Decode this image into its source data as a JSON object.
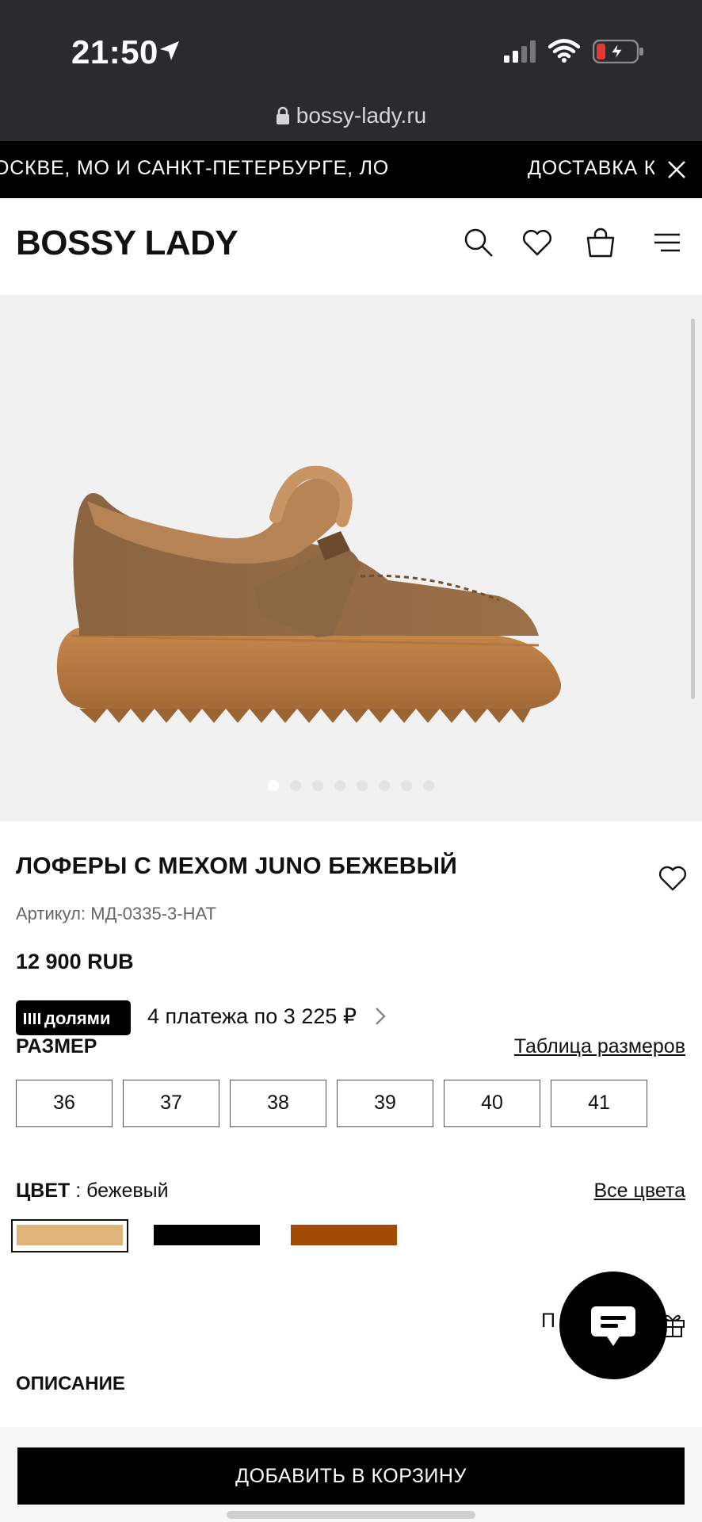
{
  "status_bar": {
    "time": "21:50",
    "url": "bossy-lady.ru",
    "battery_color": "#e53935"
  },
  "promo": {
    "text_left": "ОСКВЕ, МО И САНКТ-ПЕТЕРБУРГЕ, ЛО",
    "text_right": "ДОСТАВКА К"
  },
  "header": {
    "logo": "BOSSY LADY",
    "icons": [
      "search-icon",
      "heart-icon",
      "bag-icon",
      "menu-icon"
    ]
  },
  "gallery": {
    "image_count": 8,
    "active_index": 0,
    "background": "#f1f1f1"
  },
  "product": {
    "title": "ЛОФЕРЫ С МЕХОМ JUNO БЕЖЕВЫЙ",
    "sku": "Артикул: МД-0335-3-НАТ",
    "price": "12 900 RUB"
  },
  "installments": {
    "badge": "долями",
    "text": "4 платежа по 3 225 ₽"
  },
  "size": {
    "label": "РАЗМЕР",
    "chart_link": "Таблица размеров",
    "options": [
      "36",
      "37",
      "38",
      "39",
      "40",
      "41"
    ]
  },
  "color": {
    "label": "ЦВЕТ",
    "value": ": бежевый",
    "all_link": "Все цвета",
    "swatches": [
      "#dfb47a",
      "#000000",
      "#a04a05"
    ],
    "selected_index": 0
  },
  "partial": {
    "text": "П"
  },
  "description": {
    "label": "ОПИСАНИЕ"
  },
  "cart": {
    "button_label": "ДОБАВИТЬ В КОРЗИНУ"
  }
}
